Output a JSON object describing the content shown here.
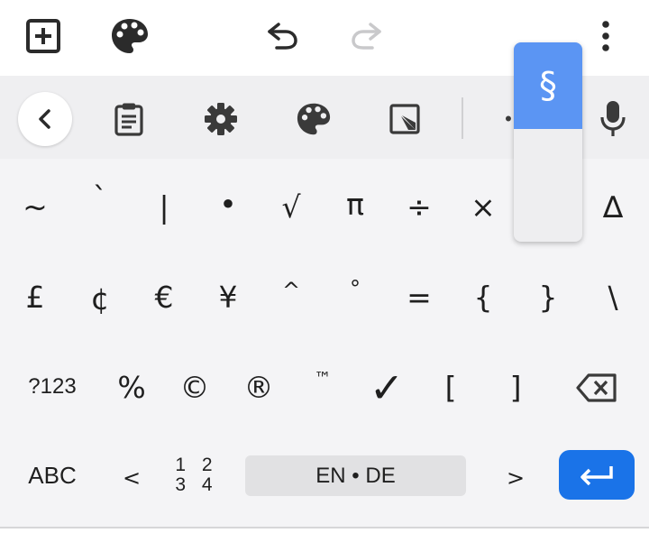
{
  "top_bar": {
    "add_icon": "add-box-icon",
    "palette_icon": "palette-icon",
    "undo_icon": "undo-icon",
    "redo_icon": "redo-icon",
    "more_icon": "more-vert-icon"
  },
  "toolbar": {
    "back_icon": "chevron-left-icon",
    "clipboard_icon": "clipboard-icon",
    "settings_icon": "gear-icon",
    "theme_icon": "palette-icon",
    "resize_icon": "resize-icon",
    "dot": "•",
    "mic_icon": "mic-icon"
  },
  "popup": {
    "selected_char": "§"
  },
  "rows": {
    "row1": [
      "~",
      "`",
      "|",
      "•",
      "√",
      "π",
      "÷",
      "×",
      "¶",
      "∆"
    ],
    "row2": [
      "£",
      "¢",
      "€",
      "¥",
      "^",
      "°",
      "=",
      "{",
      "}",
      "\\"
    ],
    "row3": [
      "?123",
      "%",
      "©",
      "®",
      "™",
      "✓",
      "[",
      "]"
    ]
  },
  "bottom_row": {
    "abc_label": "ABC",
    "less_than": "<",
    "fraction_top": "1 2",
    "fraction_bottom": "3 4",
    "space_label": "EN • DE",
    "greater_than": ">"
  },
  "colors": {
    "accent": "#1a73e8",
    "popup_selected": "#5b95f3",
    "keyboard_bg": "#f4f4f6",
    "toolbar_bg": "#efeff1"
  }
}
